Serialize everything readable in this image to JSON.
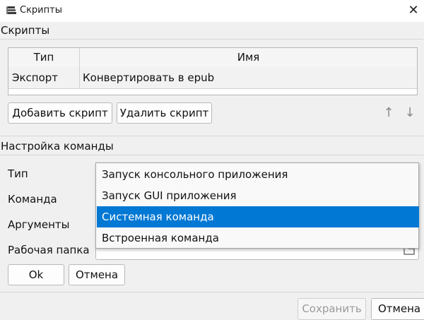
{
  "window": {
    "title": "Скрипты",
    "close_symbol": "✕"
  },
  "scripts_section": {
    "label": "Скрипты",
    "table": {
      "columns": [
        "Тип",
        "Имя"
      ],
      "rows": [
        {
          "type": "Экспорт",
          "name": "Конвертировать в epub"
        }
      ]
    },
    "add_button": "Добавить скрипт",
    "delete_button": "Удалить скрипт",
    "up_symbol": "↑",
    "down_symbol": "↓"
  },
  "command_section": {
    "label": "Настройка команды",
    "fields": {
      "type_label": "Тип",
      "command_label": "Команда",
      "args_label": "Аргументы",
      "workdir_label": "Рабочая папка"
    },
    "type_dropdown": {
      "selected_index": 2,
      "options": [
        "Запуск консольного приложения",
        "Запуск GUI приложения",
        "Системная команда",
        "Встроенная команда"
      ]
    },
    "ok_button": "Ok",
    "cancel_button": "Отмена"
  },
  "footer": {
    "save_button": "Сохранить",
    "cancel_button": "Отмена"
  },
  "colors": {
    "accent": "#0078d4",
    "window_bg": "#f0f0f0"
  },
  "icons": {
    "app": "scripts-stack-icon",
    "close": "close-icon",
    "folder": "folder-icon"
  }
}
